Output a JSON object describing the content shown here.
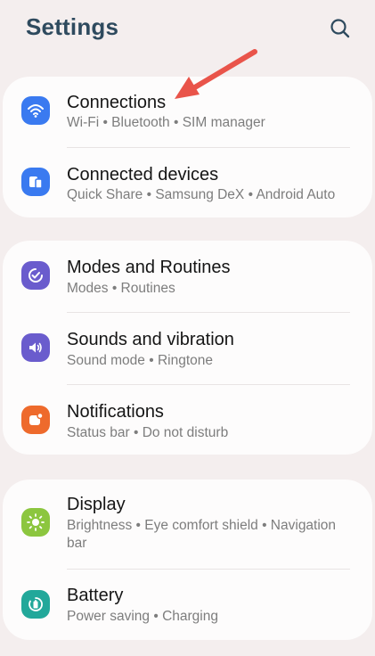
{
  "header": {
    "title": "Settings",
    "search_icon": "search-icon"
  },
  "groups": [
    {
      "items": [
        {
          "title": "Connections",
          "subtitle": "Wi-Fi  •  Bluetooth  •  SIM manager",
          "icon": "wifi-icon",
          "color": "#3a7af0"
        },
        {
          "title": "Connected devices",
          "subtitle": "Quick Share  •  Samsung DeX  •  Android Auto",
          "icon": "connected-devices-icon",
          "color": "#3a7af0"
        }
      ]
    },
    {
      "items": [
        {
          "title": "Modes and Routines",
          "subtitle": "Modes  •  Routines",
          "icon": "modes-routines-icon",
          "color": "#6a5ccd"
        },
        {
          "title": "Sounds and vibration",
          "subtitle": "Sound mode  •  Ringtone",
          "icon": "speaker-icon",
          "color": "#6a5ccd"
        },
        {
          "title": "Notifications",
          "subtitle": "Status bar  •  Do not disturb",
          "icon": "notification-icon",
          "color": "#ee6a2c"
        }
      ]
    },
    {
      "items": [
        {
          "title": "Display",
          "subtitle": "Brightness  •  Eye comfort shield  •  Navigation bar",
          "icon": "brightness-icon",
          "color": "#8cc63f"
        },
        {
          "title": "Battery",
          "subtitle": "Power saving  •  Charging",
          "icon": "battery-icon",
          "color": "#22a89a"
        }
      ]
    }
  ],
  "annotation": {
    "icon": "red-arrow-icon",
    "color": "#e9544a"
  }
}
